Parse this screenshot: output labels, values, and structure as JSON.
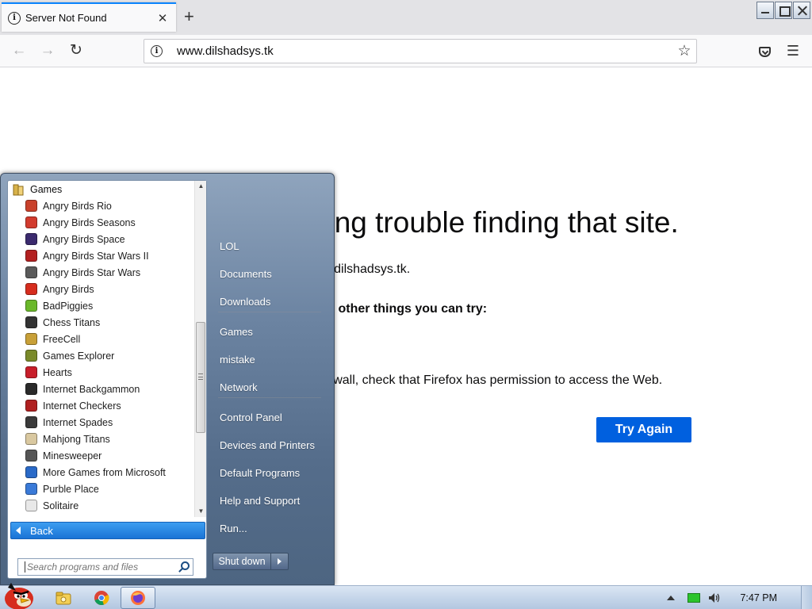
{
  "browser": {
    "tab_title": "Server Not Found",
    "url": "www.dilshadsys.tk"
  },
  "page": {
    "title": "ving trouble finding that site.",
    "description": "vw.dilshadsys.tk.",
    "suggestions_heading": "ree other things you can try:",
    "firewall_tip": "firewall, check that Firefox has permission to access the Web.",
    "try_again_label": "Try Again"
  },
  "start_menu": {
    "folder": "Games",
    "programs": [
      {
        "label": "Angry Birds Rio",
        "icon": "angry-birds-rio-icon",
        "color": "#c9412b"
      },
      {
        "label": "Angry Birds Seasons",
        "icon": "angry-birds-seasons-icon",
        "color": "#d23b2e"
      },
      {
        "label": "Angry Birds Space",
        "icon": "angry-birds-space-icon",
        "color": "#3b2a6e"
      },
      {
        "label": "Angry Birds Star Wars II",
        "icon": "angry-birds-star-wars-ii-icon",
        "color": "#b32020"
      },
      {
        "label": "Angry Birds Star Wars",
        "icon": "angry-birds-star-wars-icon",
        "color": "#5a5a5a"
      },
      {
        "label": "Angry Birds",
        "icon": "angry-birds-icon",
        "color": "#d62d1e"
      },
      {
        "label": "BadPiggies",
        "icon": "bad-piggies-icon",
        "color": "#6ab82a"
      },
      {
        "label": "Chess Titans",
        "icon": "chess-titans-icon",
        "color": "#333333"
      },
      {
        "label": "FreeCell",
        "icon": "freecell-icon",
        "color": "#c8a038"
      },
      {
        "label": "Games Explorer",
        "icon": "games-explorer-icon",
        "color": "#7a8a2a"
      },
      {
        "label": "Hearts",
        "icon": "hearts-icon",
        "color": "#c81e2a"
      },
      {
        "label": "Internet Backgammon",
        "icon": "internet-backgammon-icon",
        "color": "#2a2a2a"
      },
      {
        "label": "Internet Checkers",
        "icon": "internet-checkers-icon",
        "color": "#b02020"
      },
      {
        "label": "Internet Spades",
        "icon": "internet-spades-icon",
        "color": "#3a3a3a"
      },
      {
        "label": "Mahjong Titans",
        "icon": "mahjong-titans-icon",
        "color": "#d9c8a0"
      },
      {
        "label": "Minesweeper",
        "icon": "minesweeper-icon",
        "color": "#555555"
      },
      {
        "label": "More Games from Microsoft",
        "icon": "more-games-icon",
        "color": "#2a6ac8"
      },
      {
        "label": "Purble Place",
        "icon": "purble-place-icon",
        "color": "#3a7ad8"
      },
      {
        "label": "Solitaire",
        "icon": "solitaire-icon",
        "color": "#e8e8e8"
      }
    ],
    "back_label": "Back",
    "search_placeholder": "Search programs and files",
    "right_items": [
      "LOL",
      "Documents",
      "Downloads",
      "Games",
      "mistake",
      "Network",
      "Control Panel",
      "Devices and Printers",
      "Default Programs",
      "Help and Support",
      "Run..."
    ],
    "shutdown_label": "Shut down"
  },
  "taskbar": {
    "clock": "7:47 PM",
    "apps": [
      "windows-explorer-icon",
      "chrome-icon",
      "firefox-icon"
    ]
  }
}
